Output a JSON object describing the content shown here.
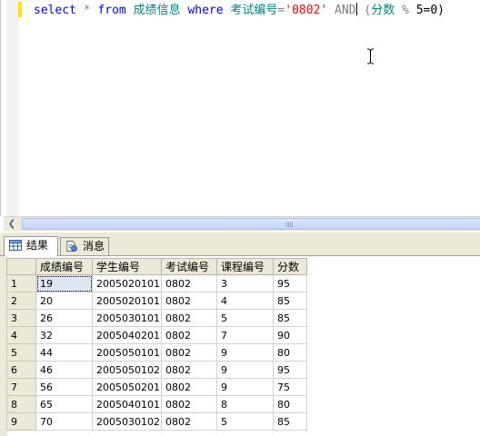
{
  "editor": {
    "sql": {
      "select": "select",
      "star": " * ",
      "from": "from",
      "table": "成绩信息",
      "where": "where",
      "exam_col": "考试编号",
      "eq": "=",
      "exam_value": "'0802'",
      "and": "AND",
      "lparen": "(",
      "score_col": "分数",
      "mod": "%",
      "rest": "5=0)"
    }
  },
  "tabs": {
    "results": "结果",
    "messages": "消息"
  },
  "grid": {
    "columns": [
      "成绩编号",
      "学生编号",
      "考试编号",
      "课程编号",
      "分数"
    ],
    "rows": [
      {
        "n": "1",
        "c": [
          "19",
          "2005020101",
          "0802",
          "3",
          "95"
        ]
      },
      {
        "n": "2",
        "c": [
          "20",
          "2005020101",
          "0802",
          "4",
          "85"
        ]
      },
      {
        "n": "3",
        "c": [
          "26",
          "2005030101",
          "0802",
          "5",
          "85"
        ]
      },
      {
        "n": "4",
        "c": [
          "32",
          "2005040201",
          "0802",
          "7",
          "90"
        ]
      },
      {
        "n": "5",
        "c": [
          "44",
          "2005050101",
          "0802",
          "9",
          "80"
        ]
      },
      {
        "n": "6",
        "c": [
          "46",
          "2005050102",
          "0802",
          "9",
          "95"
        ]
      },
      {
        "n": "7",
        "c": [
          "56",
          "2005050201",
          "0802",
          "9",
          "75"
        ]
      },
      {
        "n": "8",
        "c": [
          "65",
          "2005040101",
          "0802",
          "8",
          "80"
        ]
      },
      {
        "n": "9",
        "c": [
          "70",
          "2005030102",
          "0802",
          "5",
          "85"
        ]
      }
    ]
  },
  "colors": {
    "keyword": "#0000ff",
    "identifier": "#008080",
    "string": "#ff0000",
    "chrome": "#ece9d8"
  }
}
